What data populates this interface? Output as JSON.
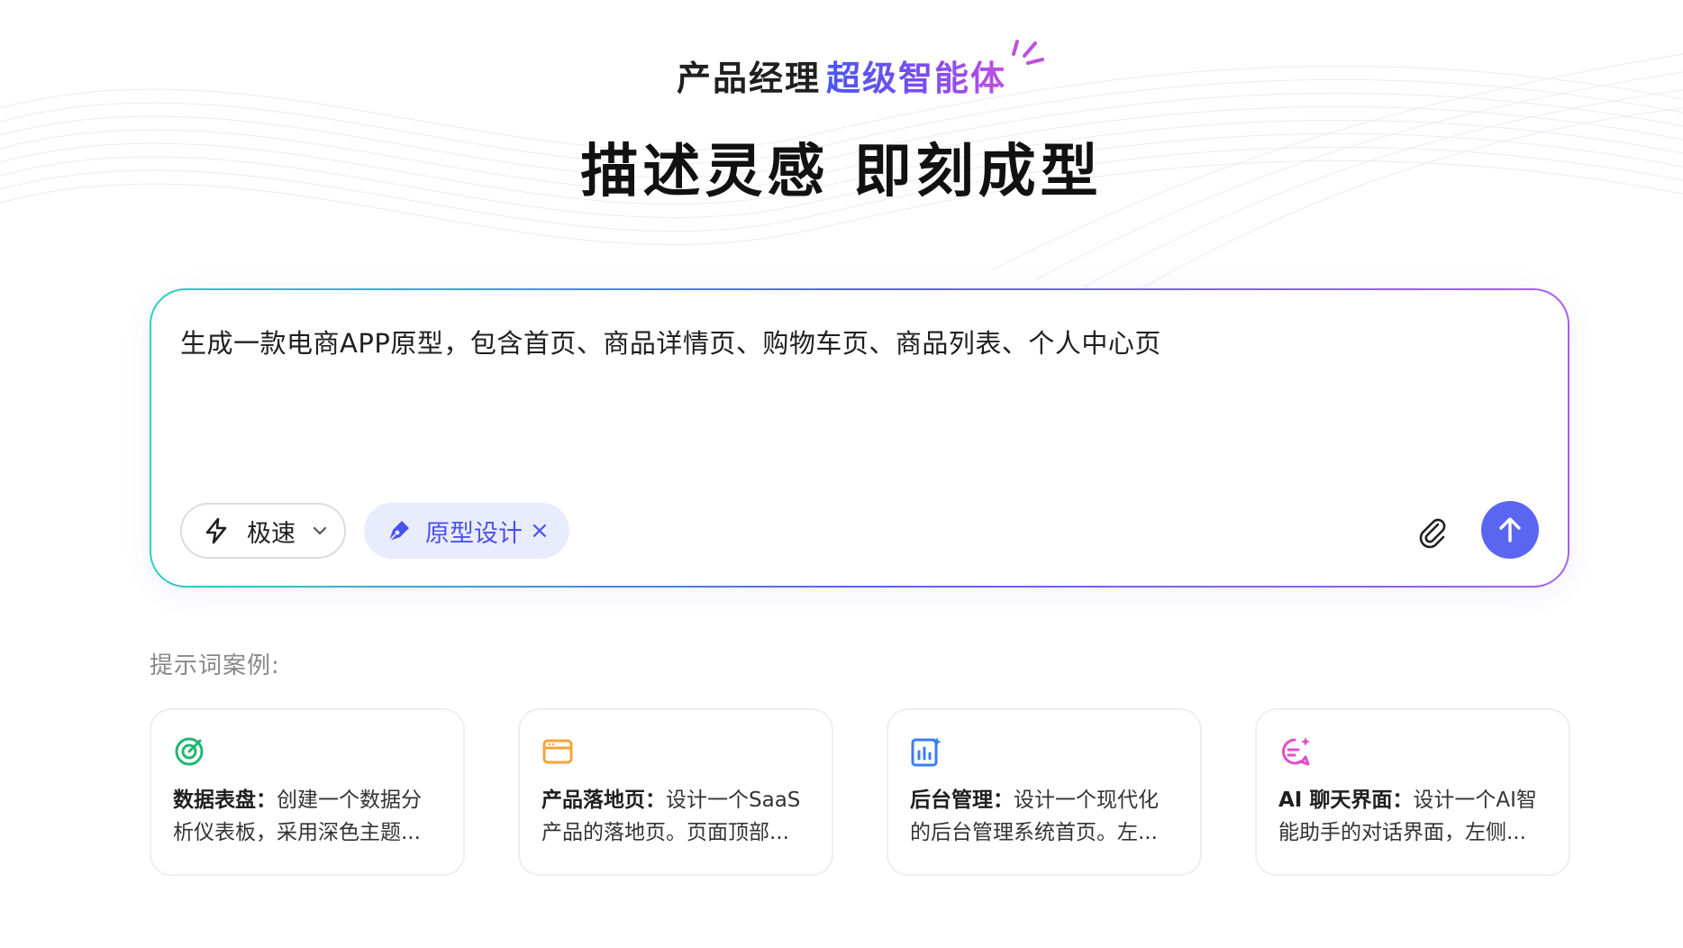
{
  "header": {
    "subtitle_plain": "产品经理",
    "subtitle_highlight": "超级智能体",
    "title": "描述灵感 即刻成型"
  },
  "input": {
    "prompt": "生成一款电商APP原型，包含首页、商品详情页、购物车页、商品列表、个人中心页",
    "mode_label": "极速",
    "tag_label": "原型设计",
    "tag_close": "×"
  },
  "examples": {
    "label": "提示词案例:",
    "cards": [
      {
        "title": "数据表盘",
        "text": "创建一个数据分析仪表板，采用深色主题...",
        "icon": "dashboard-icon",
        "color": "#22b573"
      },
      {
        "title": "产品落地页",
        "text": "设计一个SaaS产品的落地页。页面顶部...",
        "icon": "browser-window-icon",
        "color": "#f5a43a"
      },
      {
        "title": "后台管理",
        "text": "设计一个现代化的后台管理系统首页。左...",
        "icon": "chart-icon",
        "color": "#3b7df2"
      },
      {
        "title": "AI 聊天界面",
        "text": "设计一个AI智能助手的对话界面，左侧...",
        "icon": "chat-icon",
        "color": "#e04fc8"
      }
    ]
  },
  "colors": {
    "accent": "#5b66f0",
    "tag_bg": "#e9ecfd",
    "tag_text": "#4b53e8"
  }
}
